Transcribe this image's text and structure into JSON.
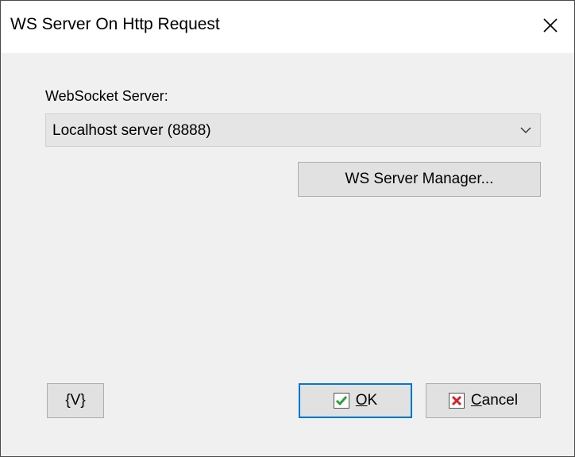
{
  "window": {
    "title": "WS Server On Http Request",
    "close_glyph": "✕",
    "close_icon": "close-icon"
  },
  "form": {
    "server_label": "WebSocket Server:",
    "server_value": "Localhost server (8888)",
    "dropdown_icon": "chevron-down-icon",
    "manager_button": "WS Server Manager..."
  },
  "footer": {
    "vars_button": "{V}",
    "ok_button": {
      "mnemonic": "O",
      "rest": "K",
      "icon": "checkmark-icon",
      "icon_color": "#2e9d3b"
    },
    "cancel_button": {
      "mnemonic": "C",
      "rest": "ancel",
      "icon": "cross-icon",
      "icon_color": "#d4252c"
    }
  },
  "colors": {
    "accent": "#0078d7",
    "dialog_bg": "#f0f0f0",
    "title_bg": "#ffffff"
  }
}
